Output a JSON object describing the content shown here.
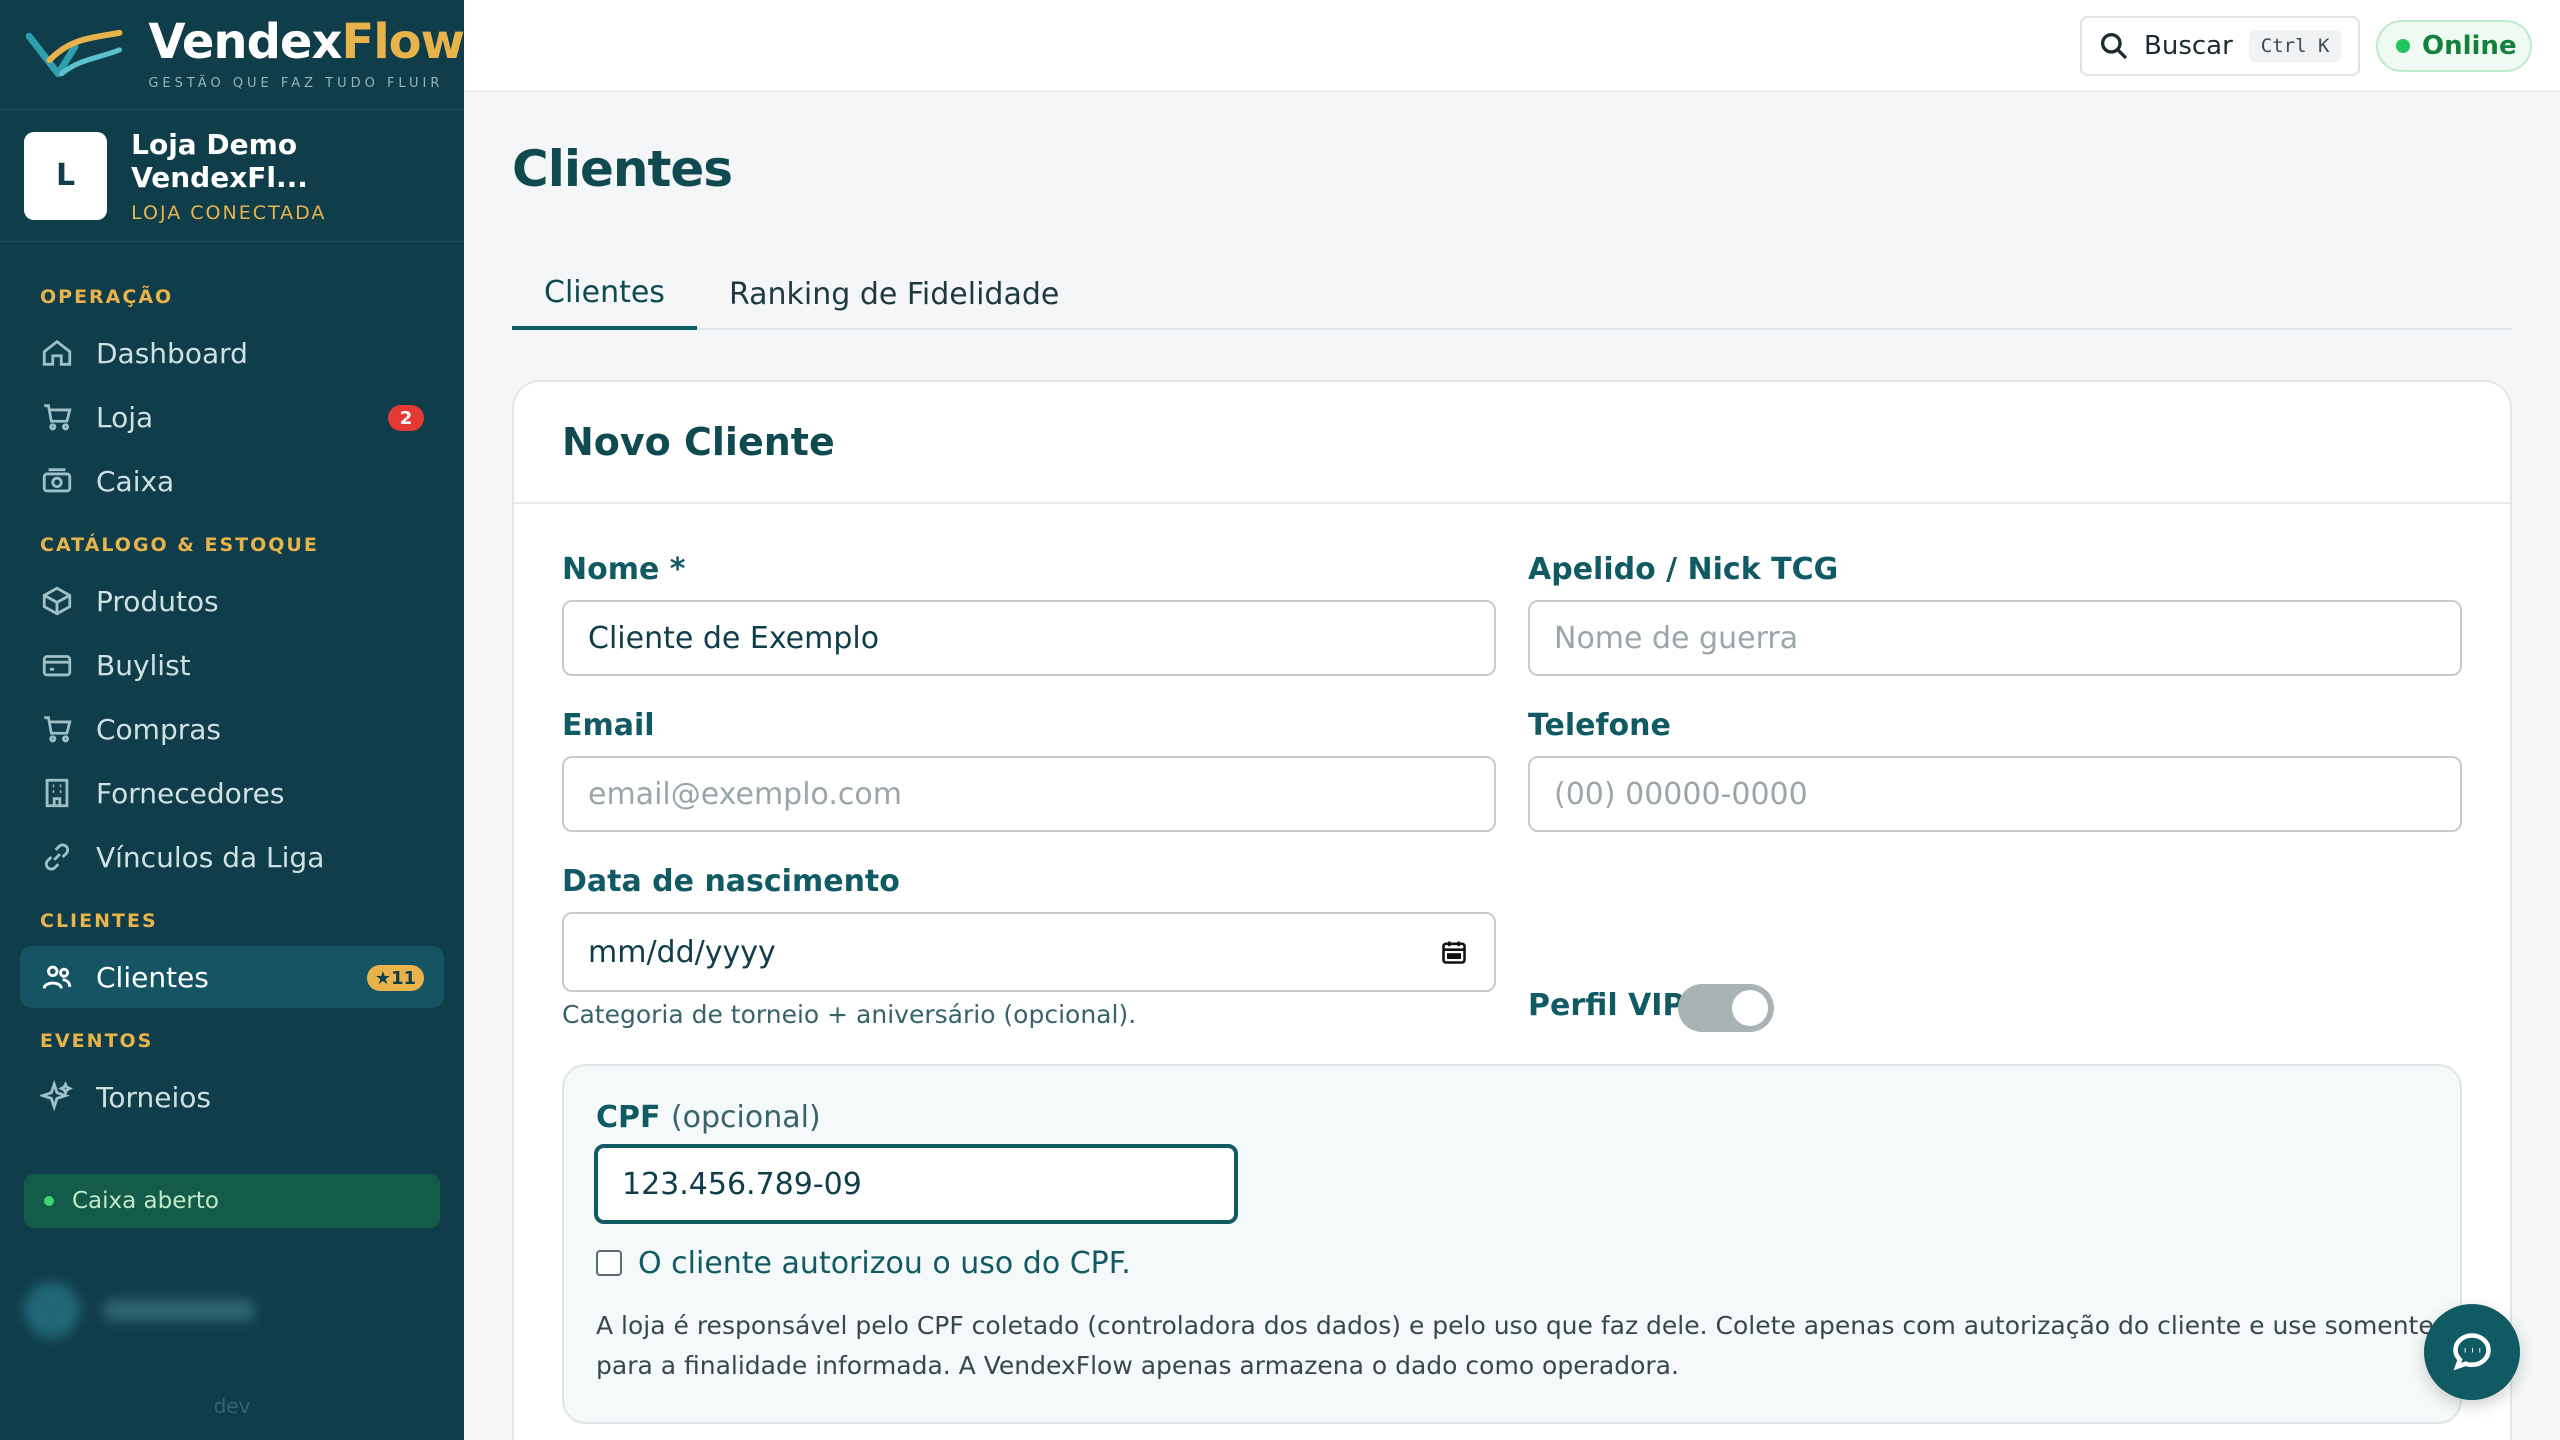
{
  "brand": {
    "name_part1": "Vendex",
    "name_part2": "Flow",
    "tagline": "GESTÃO QUE FAZ TUDO FLUIR"
  },
  "store": {
    "initial": "L",
    "name": "Loja Demo VendexFl...",
    "status": "LOJA CONECTADA"
  },
  "sidebar": {
    "sections": {
      "operacao": "OPERAÇÃO",
      "catalogo": "CATÁLOGO & ESTOQUE",
      "clientes": "CLIENTES",
      "eventos": "EVENTOS"
    },
    "items": {
      "dashboard": "Dashboard",
      "loja": "Loja",
      "loja_badge": "2",
      "caixa": "Caixa",
      "produtos": "Produtos",
      "buylist": "Buylist",
      "compras": "Compras",
      "fornecedores": "Fornecedores",
      "vinculos": "Vínculos da Liga",
      "clientes": "Clientes",
      "clientes_badge": "★11",
      "torneios": "Torneios"
    },
    "cash_status": "Caixa aberto",
    "env": "dev"
  },
  "topbar": {
    "search_label": "Buscar",
    "search_shortcut": "Ctrl K",
    "status": "Online"
  },
  "page": {
    "title": "Clientes",
    "tabs": [
      "Clientes",
      "Ranking de Fidelidade"
    ],
    "active_tab": 0
  },
  "form": {
    "title": "Novo Cliente",
    "nome_label": "Nome *",
    "nome_value": "Cliente de Exemplo",
    "apelido_label": "Apelido / Nick TCG",
    "apelido_placeholder": "Nome de guerra",
    "email_label": "Email",
    "email_placeholder": "email@exemplo.com",
    "telefone_label": "Telefone",
    "telefone_placeholder": "(00) 00000-0000",
    "nascimento_label": "Data de nascimento",
    "nascimento_placeholder": "mm/dd/yyyy",
    "nascimento_hint": "Categoria de torneio + aniversário (opcional).",
    "vip_label": "Perfil VIP",
    "vip_enabled": false,
    "cpf_label": "CPF",
    "cpf_label_suffix": "(opcional)",
    "cpf_value": "123.456.789-09",
    "cpf_consent": "O cliente autorizou o uso do CPF.",
    "cpf_consent_checked": false,
    "cpf_note": "A loja é responsável pelo CPF coletado (controladora dos dados) e pelo uso que faz dele. Colete apenas com autorização do cliente e use somente para a finalidade informada. A VendexFlow apenas armazena o dado como operadora."
  },
  "colors": {
    "sidebar_bg": "#0f3d4a",
    "accent": "#0f5a63",
    "gold": "#e8b34a",
    "online": "#22c55e",
    "badge_red": "#e53935"
  }
}
